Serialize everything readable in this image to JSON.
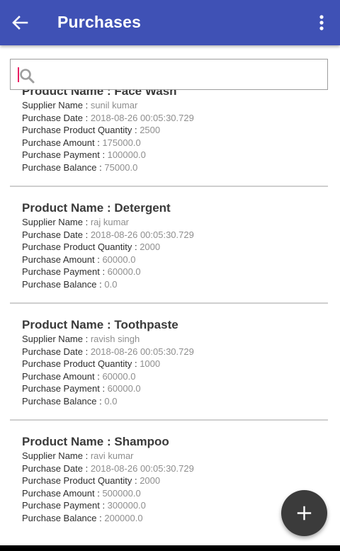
{
  "appbar": {
    "title": "Purchases",
    "back_icon": "arrow-back-icon",
    "more_icon": "more-vert-icon",
    "color": "#3f51b5"
  },
  "search": {
    "placeholder": "",
    "icon": "search-icon"
  },
  "labels": {
    "product_name": "Product Name : ",
    "supplier_name": "Supplier Name : ",
    "purchase_date": "Purchase Date : ",
    "quantity": "Purchase Product Quantity : ",
    "amount": "Purchase Amount : ",
    "payment": "Purchase Payment : ",
    "balance": "Purchase Balance : "
  },
  "purchases": [
    {
      "product": "Face Wash",
      "supplier": "sunil kumar",
      "date": "2018-08-26 00:05:30.729",
      "quantity": "2500",
      "amount": "175000.0",
      "payment": "100000.0",
      "balance": "75000.0"
    },
    {
      "product": "Detergent",
      "supplier": "raj kumar",
      "date": "2018-08-26 00:05:30.729",
      "quantity": "2000",
      "amount": "60000.0",
      "payment": "60000.0",
      "balance": "0.0"
    },
    {
      "product": "Toothpaste",
      "supplier": "ravish singh",
      "date": "2018-08-26 00:05:30.729",
      "quantity": "1000",
      "amount": "60000.0",
      "payment": "60000.0",
      "balance": "0.0"
    },
    {
      "product": "Shampoo",
      "supplier": "ravi kumar",
      "date": "2018-08-26 00:05:30.729",
      "quantity": "2000",
      "amount": "500000.0",
      "payment": "300000.0",
      "balance": "200000.0"
    }
  ],
  "fab": {
    "icon": "plus-icon",
    "color": "#3b3b3b"
  }
}
